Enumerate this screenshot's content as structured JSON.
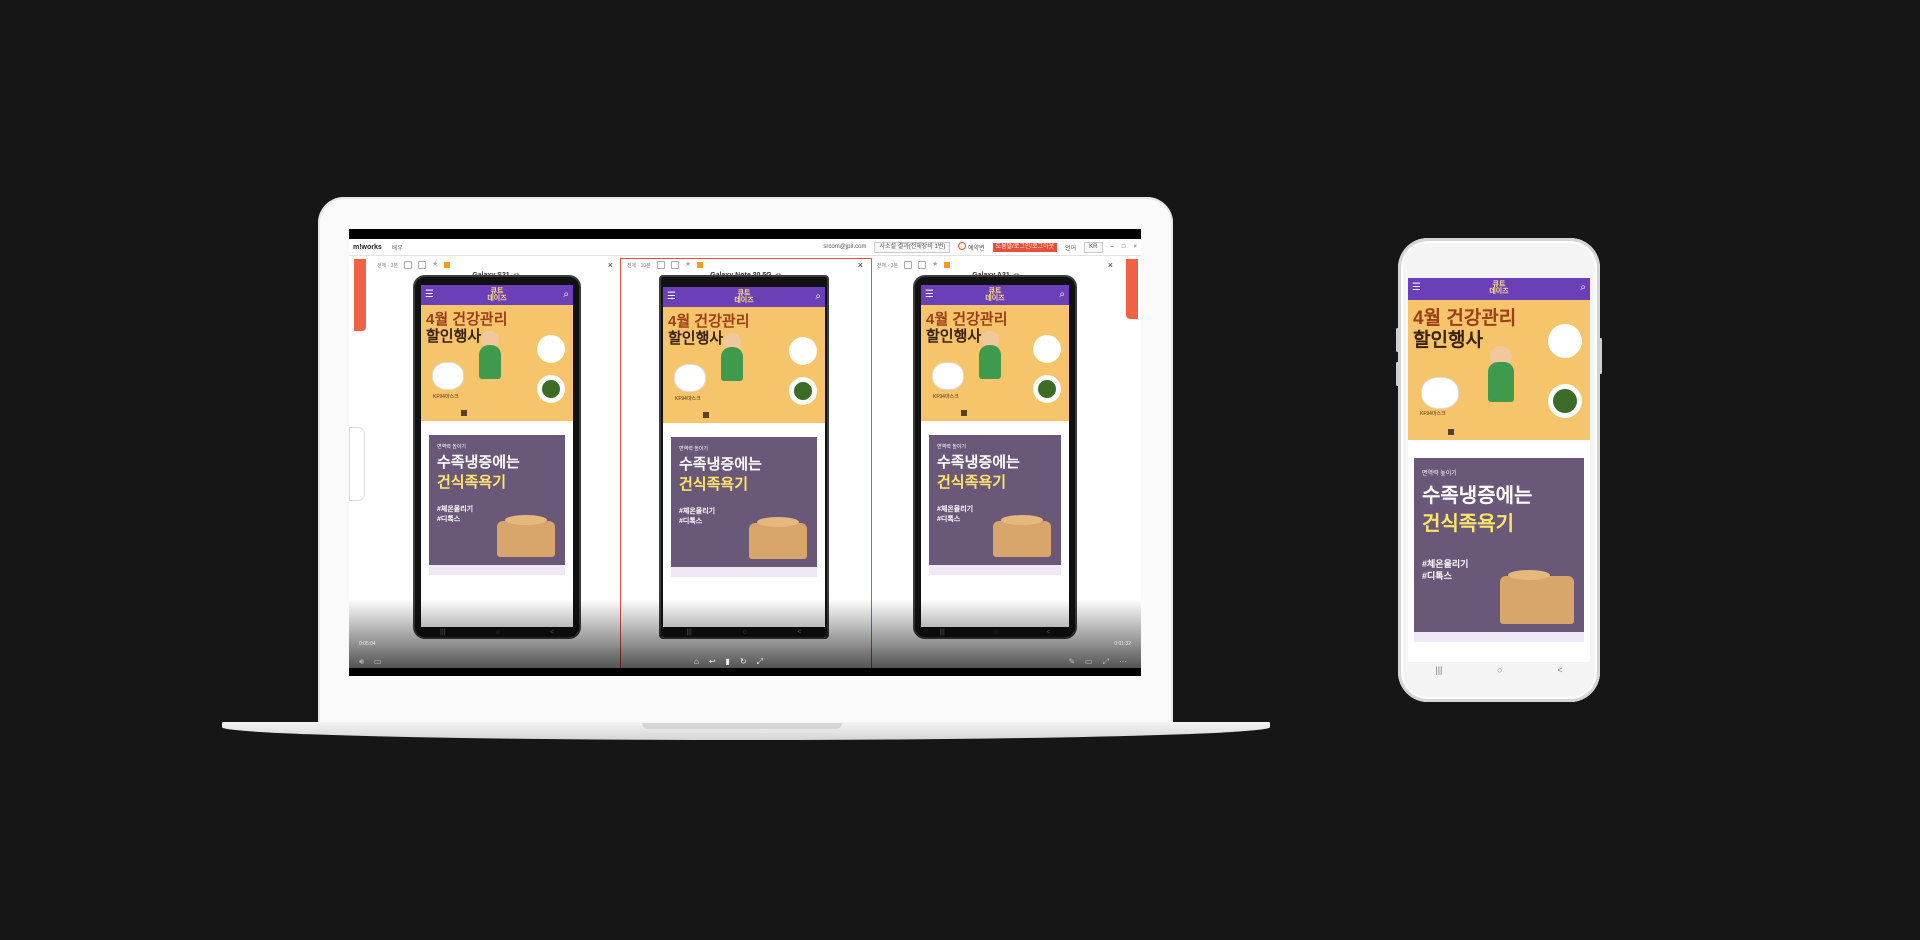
{
  "screen": {
    "brand": "m!works",
    "brand_sub": "배우",
    "user_email": "srcom@jpit.com",
    "device_select": "사소설 결과(전체장비 1번)",
    "reserve": "예약변",
    "red_button": "도움말/로그인/로그아웃",
    "lang_label": "언어",
    "lang_value": "KR",
    "time_left": "0:05:04",
    "time_right": "0:01:32"
  },
  "panels": [
    {
      "head": "전체 · 3분",
      "device": "Galaxy S21"
    },
    {
      "head": "전체 · 10분",
      "device": "Galaxy Note 20 5G"
    },
    {
      "head": "전체 · 3분",
      "device": "Galaxy A31"
    }
  ],
  "app": {
    "menu_icon": "☰",
    "logo_line1": "큐트",
    "logo_line2": "데이즈",
    "search_icon": "⌕",
    "banner1_line1": "4월 건강관리",
    "banner1_line2": "할인행사",
    "mask_label": "KF94마스크",
    "banner2_small": "면역력 높이기",
    "banner2_line1": "수족냉증에는",
    "banner2_line2": "건식족욕기",
    "tag1": "#체온올리기",
    "tag2": "#디톡스"
  },
  "softkeys": [
    "|||",
    "○",
    "<"
  ]
}
